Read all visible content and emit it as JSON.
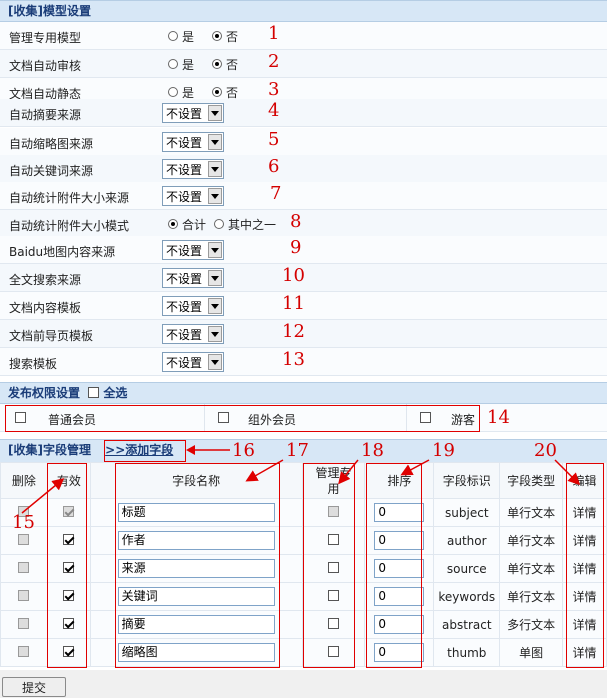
{
  "model_section": {
    "title": "[收集]模型设置"
  },
  "radio_labels": {
    "yes": "是",
    "no": "否",
    "total": "合计",
    "one_of": "其中之一"
  },
  "select_default": "不设置",
  "settings": [
    {
      "label": "管理专用模型",
      "type": "radio",
      "value": "否",
      "note": "1"
    },
    {
      "label": "文档自动审核",
      "type": "radio",
      "value": "否",
      "note": "2"
    },
    {
      "label": "文档自动静态",
      "type": "radio",
      "value": "否",
      "note": "3"
    },
    {
      "label": "自动摘要来源",
      "type": "select",
      "value": "不设置",
      "note": "4"
    },
    {
      "label": "自动缩略图来源",
      "type": "select",
      "value": "不设置",
      "note": "5"
    },
    {
      "label": "自动关键词来源",
      "type": "select",
      "value": "不设置",
      "note": "6"
    },
    {
      "label": "自动统计附件大小来源",
      "type": "select",
      "value": "不设置",
      "note": "7"
    },
    {
      "label": "自动统计附件大小模式",
      "type": "radio2",
      "value": "合计",
      "note": "8"
    },
    {
      "label": "Baidu地图内容来源",
      "type": "select",
      "value": "不设置",
      "note": "9"
    },
    {
      "label": "全文搜索来源",
      "type": "select",
      "value": "不设置",
      "note": "10"
    },
    {
      "label": "文档内容模板",
      "type": "select",
      "value": "不设置",
      "note": "11"
    },
    {
      "label": "文档前导页模板",
      "type": "select",
      "value": "不设置",
      "note": "12"
    },
    {
      "label": "搜索模板",
      "type": "select",
      "value": "不设置",
      "note": "13"
    }
  ],
  "perm_section": {
    "title": "发布权限设置",
    "select_all": "全选"
  },
  "perm_groups": [
    {
      "label": "普通会员",
      "checked": false
    },
    {
      "label": "组外会员",
      "checked": false
    },
    {
      "label": "游客",
      "checked": false
    }
  ],
  "perm_note": "14",
  "field_section": {
    "title": "[收集]字段管理",
    "add_link": ">>添加字段"
  },
  "field_headers": {
    "delete": "删除",
    "valid": "有效",
    "name": "字段名称",
    "admin1": "管理专",
    "admin2": "用",
    "order": "排序",
    "ident": "字段标识",
    "ftype": "字段类型",
    "edit": "编辑"
  },
  "fields": [
    {
      "name": "标题",
      "ident": "subject",
      "ftype": "单行文本",
      "order": "0",
      "edit": "详情",
      "valid": true,
      "fixed": true
    },
    {
      "name": "作者",
      "ident": "author",
      "ftype": "单行文本",
      "order": "0",
      "edit": "详情",
      "valid": true,
      "fixed": false
    },
    {
      "name": "来源",
      "ident": "source",
      "ftype": "单行文本",
      "order": "0",
      "edit": "详情",
      "valid": true,
      "fixed": false
    },
    {
      "name": "关键词",
      "ident": "keywords",
      "ftype": "单行文本",
      "order": "0",
      "edit": "详情",
      "valid": true,
      "fixed": false
    },
    {
      "name": "摘要",
      "ident": "abstract",
      "ftype": "多行文本",
      "order": "0",
      "edit": "详情",
      "valid": true,
      "fixed": false
    },
    {
      "name": "缩略图",
      "ident": "thumb",
      "ftype": "单图",
      "order": "0",
      "edit": "详情",
      "valid": true,
      "fixed": false
    }
  ],
  "notes": {
    "n15": "15",
    "n16": "16",
    "n17": "17",
    "n18": "18",
    "n19": "19",
    "n20": "20"
  },
  "submit_label": "提交",
  "colors": {
    "annotation": "#e00000",
    "header_bg": "#d7e7f6",
    "header_text": "#1a3c78"
  }
}
